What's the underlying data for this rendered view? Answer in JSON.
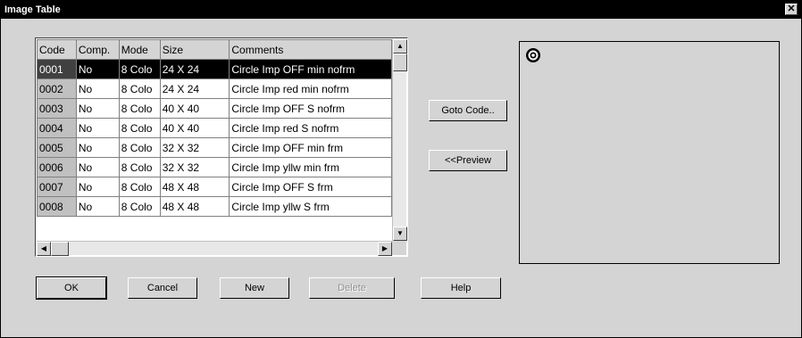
{
  "window": {
    "title": "Image Table",
    "close_symbol": "✕"
  },
  "table": {
    "columns": [
      "Code",
      "Comp.",
      "Mode",
      "Size",
      "Comments"
    ],
    "rows": [
      {
        "code": "0001",
        "comp": "No",
        "mode": "8 Colo",
        "size": "24 X 24",
        "comments": "Circle Imp OFF min nofrm",
        "selected": true
      },
      {
        "code": "0002",
        "comp": "No",
        "mode": "8 Colo",
        "size": "24 X 24",
        "comments": "Circle Imp red min nofrm"
      },
      {
        "code": "0003",
        "comp": "No",
        "mode": "8 Colo",
        "size": "40 X 40",
        "comments": "Circle Imp OFF S nofrm"
      },
      {
        "code": "0004",
        "comp": "No",
        "mode": "8 Colo",
        "size": "40 X 40",
        "comments": "Circle Imp red S nofrm"
      },
      {
        "code": "0005",
        "comp": "No",
        "mode": "8 Colo",
        "size": "32 X 32",
        "comments": "Circle Imp OFF min frm"
      },
      {
        "code": "0006",
        "comp": "No",
        "mode": "8 Colo",
        "size": "32 X 32",
        "comments": "Circle Imp yllw min frm"
      },
      {
        "code": "0007",
        "comp": "No",
        "mode": "8 Colo",
        "size": "48 X 48",
        "comments": "Circle Imp OFF S frm"
      },
      {
        "code": "0008",
        "comp": "No",
        "mode": "8 Colo",
        "size": "48 X 48",
        "comments": "Circle Imp yllw S frm"
      }
    ]
  },
  "side_buttons": {
    "goto_code": "Goto Code..",
    "preview": "<<Preview"
  },
  "bottom_buttons": {
    "ok": "OK",
    "cancel": "Cancel",
    "new": "New",
    "delete": "Delete",
    "help": "Help"
  },
  "colors": {
    "dialog_bg": "#d4d4d4",
    "title_bg": "#000000",
    "selected_row_bg": "#000000"
  }
}
